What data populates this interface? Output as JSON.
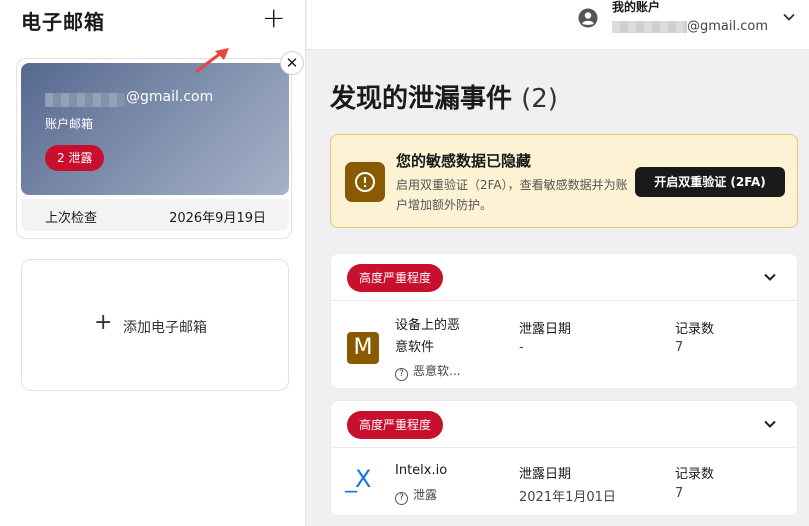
{
  "sidebar": {
    "title": "电子邮箱",
    "add_icon": "plus-icon",
    "email_card": {
      "email_suffix": "@gmail.com",
      "subtitle": "账户邮箱",
      "badge": "2 泄露",
      "last_check_label": "上次检查",
      "last_check_value": "2026年9月19日"
    },
    "add_email_label": "添加电子邮箱"
  },
  "header": {
    "account_title": "我的账户",
    "account_email_suffix": "@gmail.com"
  },
  "main": {
    "title": "发现的泄漏事件",
    "count": "(2)",
    "notice": {
      "title": "您的敏感数据已隐藏",
      "description": "启用双重验证（2FA），查看敏感数据并为账户增加额外防护。",
      "button": "开启双重验证 (2FA)"
    },
    "breaches": [
      {
        "severity": "高度严重程度",
        "logo_letter": "M",
        "name_line1": "设备上的恶",
        "name_line2": "意软件",
        "tag": "恶意软...",
        "date_label": "泄露日期",
        "date_value": "-",
        "records_label": "记录数",
        "records_value": "7"
      },
      {
        "severity": "高度严重程度",
        "logo_letter": "_X",
        "name_line1": "Intelx.io",
        "tag": "泄露",
        "date_label": "泄露日期",
        "date_value": "2021年1月01日",
        "records_label": "记录数",
        "records_value": "7"
      }
    ]
  },
  "colors": {
    "severity": "#c8102e",
    "notice_bg": "#fdf3d4",
    "notice_icon": "#8a5a00",
    "card_gradient_start": "#56688f",
    "card_gradient_end": "#a8b2c8"
  }
}
